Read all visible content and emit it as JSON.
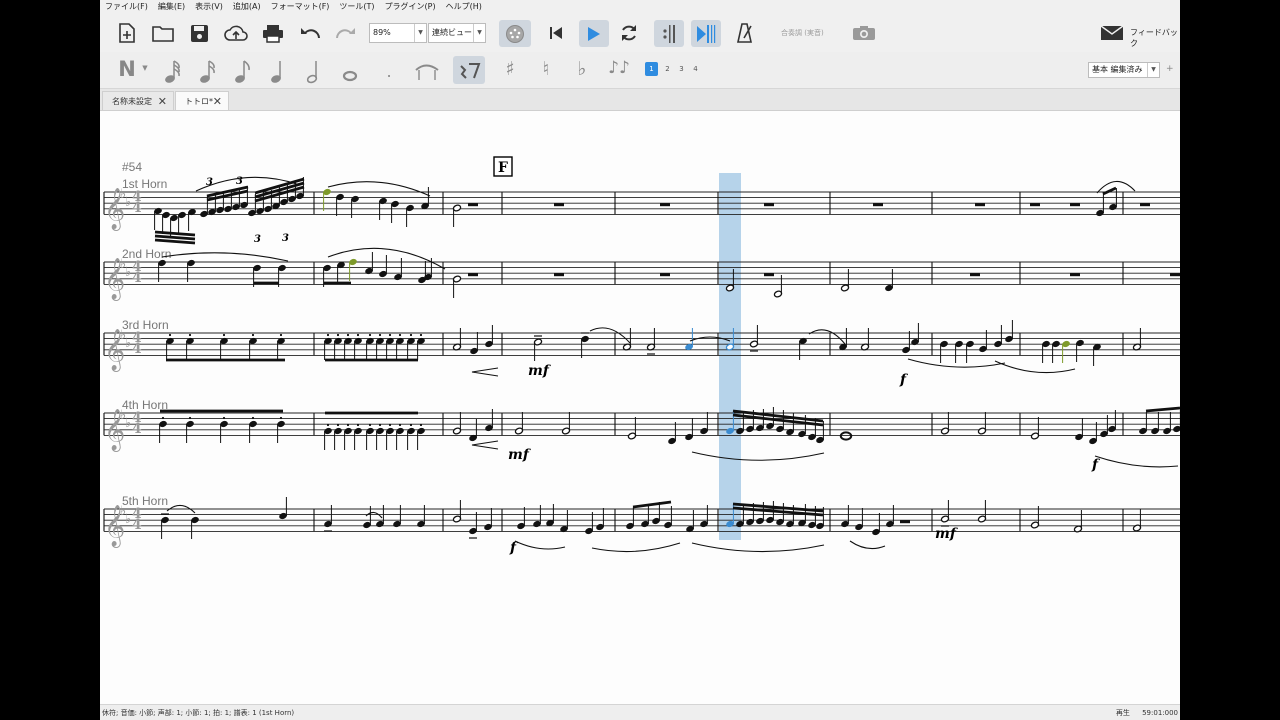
{
  "menu": [
    "ファイル(F)",
    "編集(E)",
    "表示(V)",
    "追加(A)",
    "フォーマット(F)",
    "ツール(T)",
    "プラグイン(P)",
    "ヘルプ(H)"
  ],
  "toolbar": {
    "zoom_value": "89%",
    "view_mode": "連続ビュー",
    "concert_pitch": "合奏調 (実音)",
    "feedback": "フィードバック"
  },
  "note_input": {
    "voices": [
      "1",
      "2",
      "3",
      "4"
    ],
    "workspace": "基本 編集済み",
    "add": "+"
  },
  "tabs": [
    {
      "label": "名称未設定",
      "active": false
    },
    {
      "label": "トトロ*",
      "active": true
    }
  ],
  "score": {
    "measure_number": "#54",
    "rehearsal_mark": "F",
    "instruments": [
      "1st Horn",
      "2nd Horn",
      "3rd Horn",
      "4th Horn",
      "5th Horn"
    ],
    "dynamics": [
      "mf",
      "f",
      "mf",
      "f",
      "f",
      "mf"
    ],
    "tuplets": [
      "3",
      "3",
      "3",
      "3"
    ]
  },
  "status": {
    "selection": "休符; 音価: 小節; 声部: 1;  小節: 1; 拍: 1; 譜表: 1 (1st Horn)",
    "mode": "再生",
    "time": "59:01:000"
  },
  "colors": {
    "accent": "#2f8ce0",
    "selection": "#b6d3ea",
    "highlight_note": "#3a8bd0",
    "green_note": "#7e9a2a"
  }
}
